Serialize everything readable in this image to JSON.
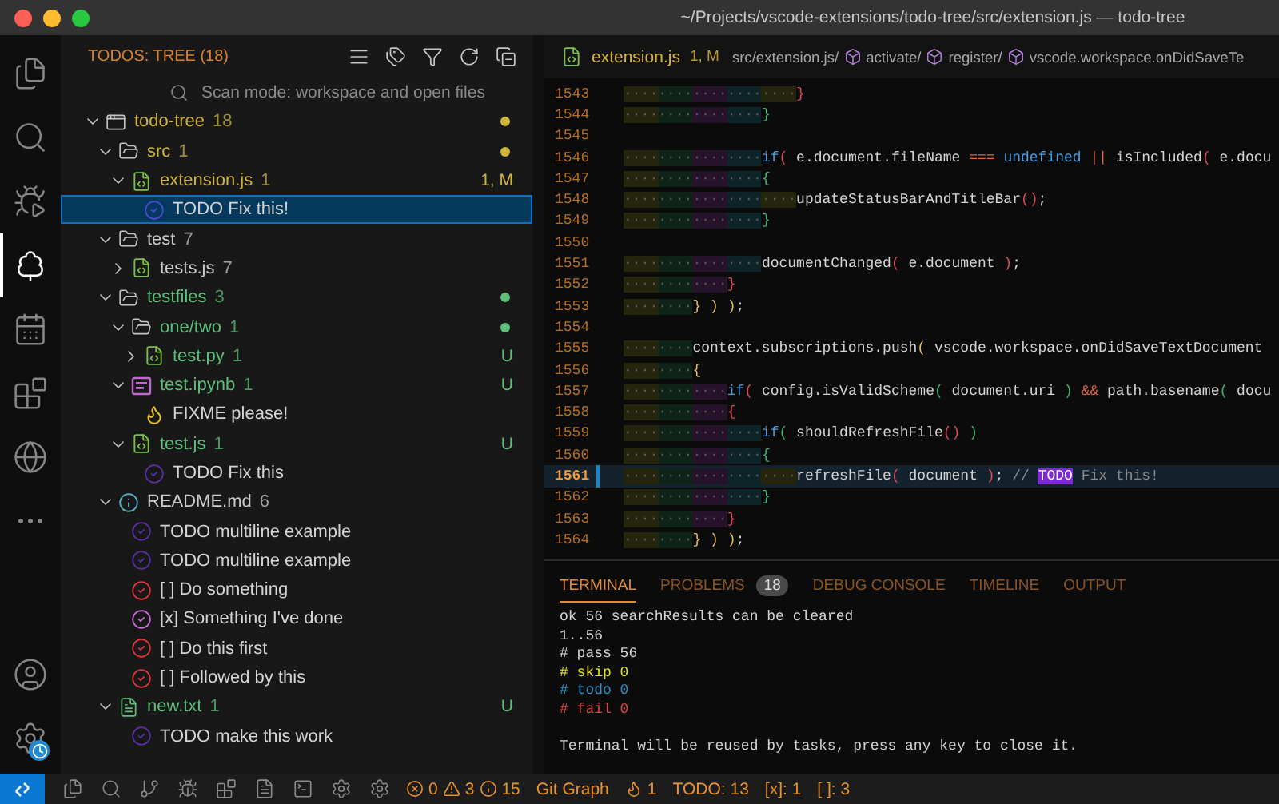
{
  "window": {
    "title": "~/Projects/vscode-extensions/todo-tree/src/extension.js — todo-tree"
  },
  "activity_bar": {
    "top": [
      {
        "kind": "explorer",
        "selected": false
      },
      {
        "kind": "search",
        "selected": false
      },
      {
        "kind": "debug",
        "selected": false
      },
      {
        "kind": "todo_tree",
        "selected": true
      },
      {
        "kind": "calendar",
        "selected": false
      },
      {
        "kind": "extensions",
        "selected": false
      },
      {
        "kind": "globe",
        "selected": false
      },
      {
        "kind": "more",
        "selected": false
      }
    ],
    "bottom": [
      {
        "kind": "account",
        "selected": false
      },
      {
        "kind": "settings",
        "selected": false
      }
    ]
  },
  "sidebar": {
    "title": "TODOS: TREE (18)",
    "actions": [
      {
        "kind": "list"
      },
      {
        "kind": "tags"
      },
      {
        "kind": "filter"
      },
      {
        "kind": "refresh"
      },
      {
        "kind": "collapse"
      }
    ],
    "scan_mode": "Scan mode: workspace and open files",
    "tree": [
      {
        "kind": "workspace",
        "label": "todo-tree",
        "count": "18",
        "color": "#cfb53e",
        "dot": true,
        "expanded": true,
        "children": [
          {
            "kind": "folder",
            "label": "src",
            "count": "1",
            "color": "#cfb53e",
            "dot": true,
            "expanded": true,
            "children": [
              {
                "kind": "code_file",
                "label": "extension.js",
                "count": "1",
                "color": "#cfb53e",
                "dot": false,
                "badge": "1, M",
                "expanded": true,
                "children": [
                  {
                    "kind": "todo",
                    "label": "TODO Fix this!",
                    "selected": true
                  }
                ]
              }
            ]
          },
          {
            "kind": "folder",
            "label": "test",
            "count": "7",
            "color": "#cccccc",
            "dot": false,
            "expanded": true,
            "children": [
              {
                "kind": "code_file",
                "label": "tests.js",
                "count": "7",
                "color": "#cccccc",
                "dot": false,
                "expanded": false
              }
            ]
          },
          {
            "kind": "folder",
            "label": "testfiles",
            "count": "3",
            "color": "#5fbf7a",
            "dot": true,
            "expanded": true,
            "children": [
              {
                "kind": "folder",
                "label": "one/two",
                "count": "1",
                "color": "#5fbf7a",
                "dot": true,
                "expanded": true,
                "children": [
                  {
                    "kind": "code_file",
                    "label": "test.py",
                    "count": "1",
                    "color": "#5fbf7a",
                    "dot": false,
                    "badge": "U",
                    "expanded": false
                  }
                ]
              },
              {
                "kind": "notebook_file",
                "label": "test.ipynb",
                "count": "1",
                "color": "#5fbf7a",
                "dot": false,
                "badge": "U",
                "expanded": true,
                "children": [
                  {
                    "kind": "fixme",
                    "label": "FIXME please!",
                    "selected": false
                  }
                ]
              },
              {
                "kind": "code_file",
                "label": "test.js",
                "count": "1",
                "color": "#5fbf7a",
                "dot": false,
                "badge": "U",
                "expanded": true,
                "children": [
                  {
                    "kind": "todo",
                    "label": "TODO Fix this",
                    "selected": false
                  }
                ]
              }
            ]
          },
          {
            "kind": "info_file",
            "label": "README.md",
            "count": "6",
            "color": "#cccccc",
            "dot": false,
            "expanded": true,
            "children": [
              {
                "kind": "todo",
                "label": "TODO multiline example",
                "selected": false
              },
              {
                "kind": "todo",
                "label": "TODO multiline example",
                "selected": false
              },
              {
                "kind": "task_open",
                "label": "[ ] Do something",
                "selected": false
              },
              {
                "kind": "task_done",
                "label": "[x] Something I've done",
                "selected": false
              },
              {
                "kind": "task_open",
                "label": "[ ] Do this first",
                "selected": false
              },
              {
                "kind": "task_open",
                "label": "[ ] Followed by this",
                "selected": false
              }
            ]
          },
          {
            "kind": "text_file",
            "label": "new.txt",
            "count": "1",
            "color": "#5fbf7a",
            "dot": false,
            "badge": "U",
            "expanded": true,
            "children": [
              {
                "kind": "todo",
                "label": "TODO make this work",
                "selected": false
              }
            ]
          }
        ]
      }
    ]
  },
  "editor": {
    "tab": {
      "label": "extension.js",
      "status": "1, M"
    },
    "breadcrumbs": [
      {
        "kind": "file",
        "label": "src/extension.js/"
      },
      {
        "kind": "symbol",
        "label": "activate/"
      },
      {
        "kind": "symbol",
        "label": "register/"
      },
      {
        "kind": "symbol",
        "label": "vscode.workspace.onDidSaveTe"
      }
    ],
    "lines": [
      {
        "number": "1543",
        "indent": "····················",
        "tokens": [
          {
            "kind": "br1",
            "text": "}"
          }
        ],
        "current": false,
        "modified": false
      },
      {
        "number": "1544",
        "indent": "················",
        "tokens": [
          {
            "kind": "br2",
            "text": "}"
          }
        ],
        "current": false,
        "modified": false
      },
      {
        "number": "1545",
        "current": false,
        "modified": false
      },
      {
        "number": "1546",
        "indent": "················",
        "tokens": [
          {
            "kind": "kw",
            "text": "if"
          },
          {
            "kind": "br1",
            "text": "("
          },
          {
            "kind": "pl",
            "text": " e.document.fileName "
          },
          {
            "kind": "op",
            "text": "=== "
          },
          {
            "kind": "kw",
            "text": "undefined "
          },
          {
            "kind": "op",
            "text": "||"
          },
          {
            "kind": "pl",
            "text": " isIncluded"
          },
          {
            "kind": "br1",
            "text": "("
          },
          {
            "kind": "pl",
            "text": " e.docu"
          }
        ],
        "current": false,
        "modified": false
      },
      {
        "number": "1547",
        "indent": "················",
        "tokens": [
          {
            "kind": "br2",
            "text": "{"
          }
        ],
        "current": false,
        "modified": false
      },
      {
        "number": "1548",
        "indent": "····················",
        "tokens": [
          {
            "kind": "pl",
            "text": "updateStatusBarAndTitleBar"
          },
          {
            "kind": "br1",
            "text": "()"
          },
          {
            "kind": "pl",
            "text": ";"
          }
        ],
        "current": false,
        "modified": false
      },
      {
        "number": "1549",
        "indent": "················",
        "tokens": [
          {
            "kind": "br2",
            "text": "}"
          }
        ],
        "current": false,
        "modified": false
      },
      {
        "number": "1550",
        "current": false,
        "modified": false
      },
      {
        "number": "1551",
        "indent": "················",
        "tokens": [
          {
            "kind": "pl",
            "text": "documentChanged"
          },
          {
            "kind": "br1",
            "text": "("
          },
          {
            "kind": "pl",
            "text": " e.document "
          },
          {
            "kind": "br1",
            "text": ")"
          },
          {
            "kind": "pl",
            "text": ";"
          }
        ],
        "current": false,
        "modified": false
      },
      {
        "number": "1552",
        "indent": "············",
        "tokens": [
          {
            "kind": "br1",
            "text": "}"
          }
        ],
        "current": false,
        "modified": false
      },
      {
        "number": "1553",
        "indent": "········",
        "tokens": [
          {
            "kind": "br3",
            "text": "} ) )"
          },
          {
            "kind": "pl",
            "text": ";"
          }
        ],
        "current": false,
        "modified": false
      },
      {
        "number": "1554",
        "current": false,
        "modified": false
      },
      {
        "number": "1555",
        "indent": "········",
        "tokens": [
          {
            "kind": "pl",
            "text": "context.subscriptions.push"
          },
          {
            "kind": "br3",
            "text": "("
          },
          {
            "kind": "pl",
            "text": " vscode.workspace.onDidSaveTextDocument"
          }
        ],
        "current": false,
        "modified": false
      },
      {
        "number": "1556",
        "indent": "········",
        "tokens": [
          {
            "kind": "br3",
            "text": "{"
          }
        ],
        "current": false,
        "modified": false
      },
      {
        "number": "1557",
        "indent": "············",
        "tokens": [
          {
            "kind": "kw",
            "text": "if"
          },
          {
            "kind": "br1",
            "text": "("
          },
          {
            "kind": "pl",
            "text": " config.isValidScheme"
          },
          {
            "kind": "br2",
            "text": "("
          },
          {
            "kind": "pl",
            "text": " document.uri "
          },
          {
            "kind": "br2",
            "text": ") "
          },
          {
            "kind": "op",
            "text": "&&"
          },
          {
            "kind": "pl",
            "text": " path.basename"
          },
          {
            "kind": "br2",
            "text": "("
          },
          {
            "kind": "pl",
            "text": " docu"
          }
        ],
        "current": false,
        "modified": false
      },
      {
        "number": "1558",
        "indent": "············",
        "tokens": [
          {
            "kind": "br1",
            "text": "{"
          }
        ],
        "current": false,
        "modified": false
      },
      {
        "number": "1559",
        "indent": "················",
        "tokens": [
          {
            "kind": "kw",
            "text": "if"
          },
          {
            "kind": "br2",
            "text": "("
          },
          {
            "kind": "pl",
            "text": " shouldRefreshFile"
          },
          {
            "kind": "br1",
            "text": "() "
          },
          {
            "kind": "br2",
            "text": ")"
          }
        ],
        "current": false,
        "modified": false
      },
      {
        "number": "1560",
        "indent": "················",
        "tokens": [
          {
            "kind": "br2",
            "text": "{"
          }
        ],
        "current": false,
        "modified": false
      },
      {
        "number": "1561",
        "indent": "····················",
        "tokens": [
          {
            "kind": "pl",
            "text": "refreshFile"
          },
          {
            "kind": "br1",
            "text": "("
          },
          {
            "kind": "pl",
            "text": " document "
          },
          {
            "kind": "br1",
            "text": ")"
          },
          {
            "kind": "pl",
            "text": "; "
          },
          {
            "kind": "cm",
            "text": "// "
          },
          {
            "kind": "tag",
            "text": "TODO"
          },
          {
            "kind": "cm",
            "text": " Fix this!"
          }
        ],
        "current": true,
        "modified": true
      },
      {
        "number": "1562",
        "indent": "················",
        "tokens": [
          {
            "kind": "br2",
            "text": "}"
          }
        ],
        "current": false,
        "modified": false
      },
      {
        "number": "1563",
        "indent": "············",
        "tokens": [
          {
            "kind": "br1",
            "text": "}"
          }
        ],
        "current": false,
        "modified": false
      },
      {
        "number": "1564",
        "indent": "········",
        "tokens": [
          {
            "kind": "br3",
            "text": "} ) )"
          },
          {
            "kind": "pl",
            "text": ";"
          }
        ],
        "current": false,
        "modified": false
      }
    ]
  },
  "panel": {
    "tabs": [
      {
        "label": "TERMINAL",
        "selected": true
      },
      {
        "label": "PROBLEMS",
        "badge": "18",
        "selected": false
      },
      {
        "label": "DEBUG CONSOLE",
        "selected": false
      },
      {
        "label": "TIMELINE",
        "selected": false
      },
      {
        "label": "OUTPUT",
        "selected": false
      }
    ],
    "lines": [
      {
        "text": "ok 56 searchResults can be cleared",
        "color": "#d4d4d4"
      },
      {
        "text": "1..56",
        "color": "#d4d4d4"
      },
      {
        "text": "# pass 56",
        "color": "#d4d4d4"
      },
      {
        "text": "# skip 0",
        "color": "#e5e510"
      },
      {
        "text": "# todo 0",
        "color": "#2b8fc6"
      },
      {
        "text": "# fail 0",
        "color": "#e0443e"
      }
    ],
    "notice": "Terminal will be reused by tasks, press any key to close it."
  },
  "status_bar": {
    "icons": [
      {
        "kind": "remote"
      },
      {
        "kind": "files"
      },
      {
        "kind": "search"
      },
      {
        "kind": "branch"
      },
      {
        "kind": "bug"
      },
      {
        "kind": "extensions"
      },
      {
        "kind": "notes"
      },
      {
        "kind": "terminal"
      },
      {
        "kind": "gear"
      },
      {
        "kind": "gear"
      }
    ],
    "problems": {
      "errors": "0",
      "warnings": "3",
      "infos": "15"
    },
    "items": [
      {
        "kind": "text",
        "label": "Git Graph"
      },
      {
        "kind": "fixme",
        "label": "1"
      },
      {
        "kind": "text",
        "label": "TODO: 13"
      },
      {
        "kind": "text",
        "label": "[x]: 1"
      },
      {
        "kind": "text",
        "label": "[ ]: 3"
      }
    ]
  }
}
